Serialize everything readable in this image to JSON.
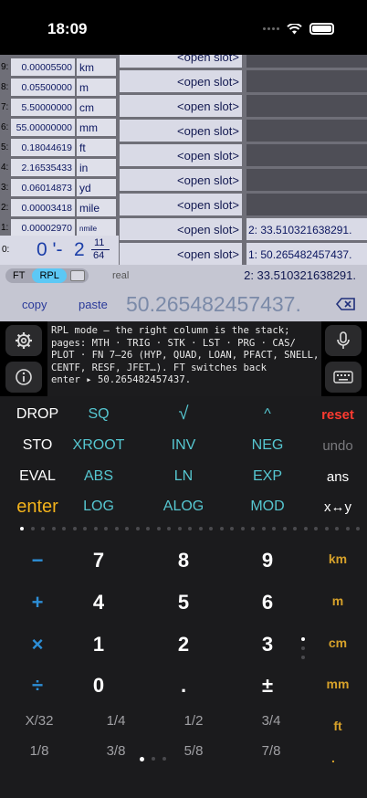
{
  "status": {
    "time": "18:09"
  },
  "registers": [
    {
      "idx": "9:",
      "value": "0.00005500",
      "unit": "km"
    },
    {
      "idx": "8:",
      "value": "0.05500000",
      "unit": "m"
    },
    {
      "idx": "7:",
      "value": "5.50000000",
      "unit": "cm"
    },
    {
      "idx": "6:",
      "value": "55.00000000",
      "unit": "mm"
    },
    {
      "idx": "5:",
      "value": "0.18044619",
      "unit": "ft"
    },
    {
      "idx": "4:",
      "value": "2.16535433",
      "unit": "in"
    },
    {
      "idx": "3:",
      "value": "0.06014873",
      "unit": "yd"
    },
    {
      "idx": "2:",
      "value": "0.00003418",
      "unit": "mile"
    },
    {
      "idx": "1:",
      "value": "0.00002970",
      "unit": "nmile"
    }
  ],
  "fraction": {
    "idx": "0:",
    "feet": "0 '-",
    "whole": "2",
    "numerator": "11",
    "denominator": "64"
  },
  "slots": [
    "<open slot>",
    "<open slot>",
    "<open slot>",
    "<open slot>",
    "<open slot>",
    "<open slot>",
    "<open slot>",
    "<open slot>",
    "<open slot>",
    "<open slot>",
    "<open slot>"
  ],
  "stack_panel": [
    "2: 33.510321638291.",
    "1: 50.265482457437."
  ],
  "mode": {
    "ft": "FT",
    "rpl": "RPL",
    "real": "real",
    "stack2": "2: 33.510321638291."
  },
  "edit": {
    "copy": "copy",
    "paste": "paste",
    "display": "50.265482457437."
  },
  "help": {
    "text": "RPL mode — the right column is the stack; pages: MTH · TRIG · STK · LST · PRG · CAS/ PLOT · FN 7–26 (HYP, QUAD, LOAN, PFACT, SNELL, CENTF, RESF, JFET…). FT switches back\nenter ▸ 50.265482457437."
  },
  "keys": {
    "row1": [
      "DROP",
      "SQ",
      "√",
      "^",
      "reset"
    ],
    "row2": [
      "STO",
      "XROOT",
      "INV",
      "NEG",
      "undo"
    ],
    "row3": [
      "EVAL",
      "ABS",
      "LN",
      "EXP",
      "ans"
    ],
    "row4": [
      "enter",
      "LOG",
      "ALOG",
      "MOD",
      "x↔y"
    ],
    "pad": [
      [
        "−",
        "7",
        "8",
        "9",
        "km"
      ],
      [
        "+",
        "4",
        "5",
        "6",
        "m"
      ],
      [
        "×",
        "1",
        "2",
        "3",
        "cm"
      ],
      [
        "÷",
        "0",
        ".",
        "±",
        "mm"
      ]
    ],
    "fracs1": [
      "X/32",
      "1/4",
      "1/2",
      "3/4",
      "ft"
    ],
    "fracs2": [
      "1/8",
      "3/8",
      "5/8",
      "7/8",
      "."
    ]
  },
  "colors": {
    "teal_label": "#56c7d1",
    "reset_red": "#ff3b30",
    "enter_gold": "#f2b21b",
    "operator_blue": "#2d8ed6",
    "unit_gold": "#d6a12a",
    "rpl_active": "#5cc8f5"
  }
}
